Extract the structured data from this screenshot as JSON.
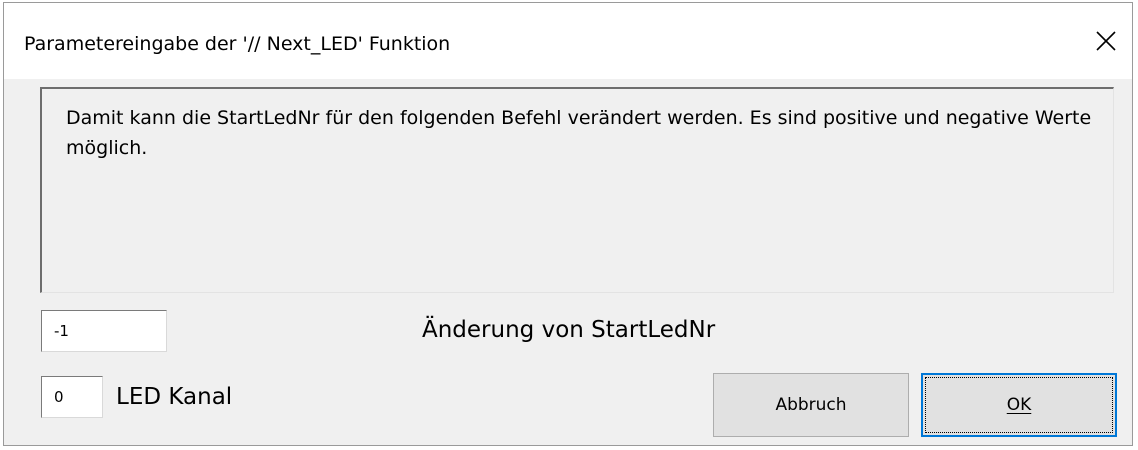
{
  "window": {
    "title": "Parametereingabe der '// Next_LED' Funktion",
    "close_icon": "close-icon"
  },
  "info": {
    "text": "Damit kann die StartLedNr für den folgenden Befehl verändert werden. Es sind positive und negative Werte möglich."
  },
  "fields": {
    "delta_value": "-1",
    "delta_label": "Änderung von StartLedNr",
    "channel_value": "0",
    "channel_label": "LED Kanal"
  },
  "buttons": {
    "cancel_label": "Abbruch",
    "ok_label": "OK"
  },
  "colors": {
    "dialog_bg": "#f0f0f0",
    "titlebar_bg": "#ffffff",
    "default_button_border": "#0078d7",
    "button_bg": "#e1e1e1"
  }
}
